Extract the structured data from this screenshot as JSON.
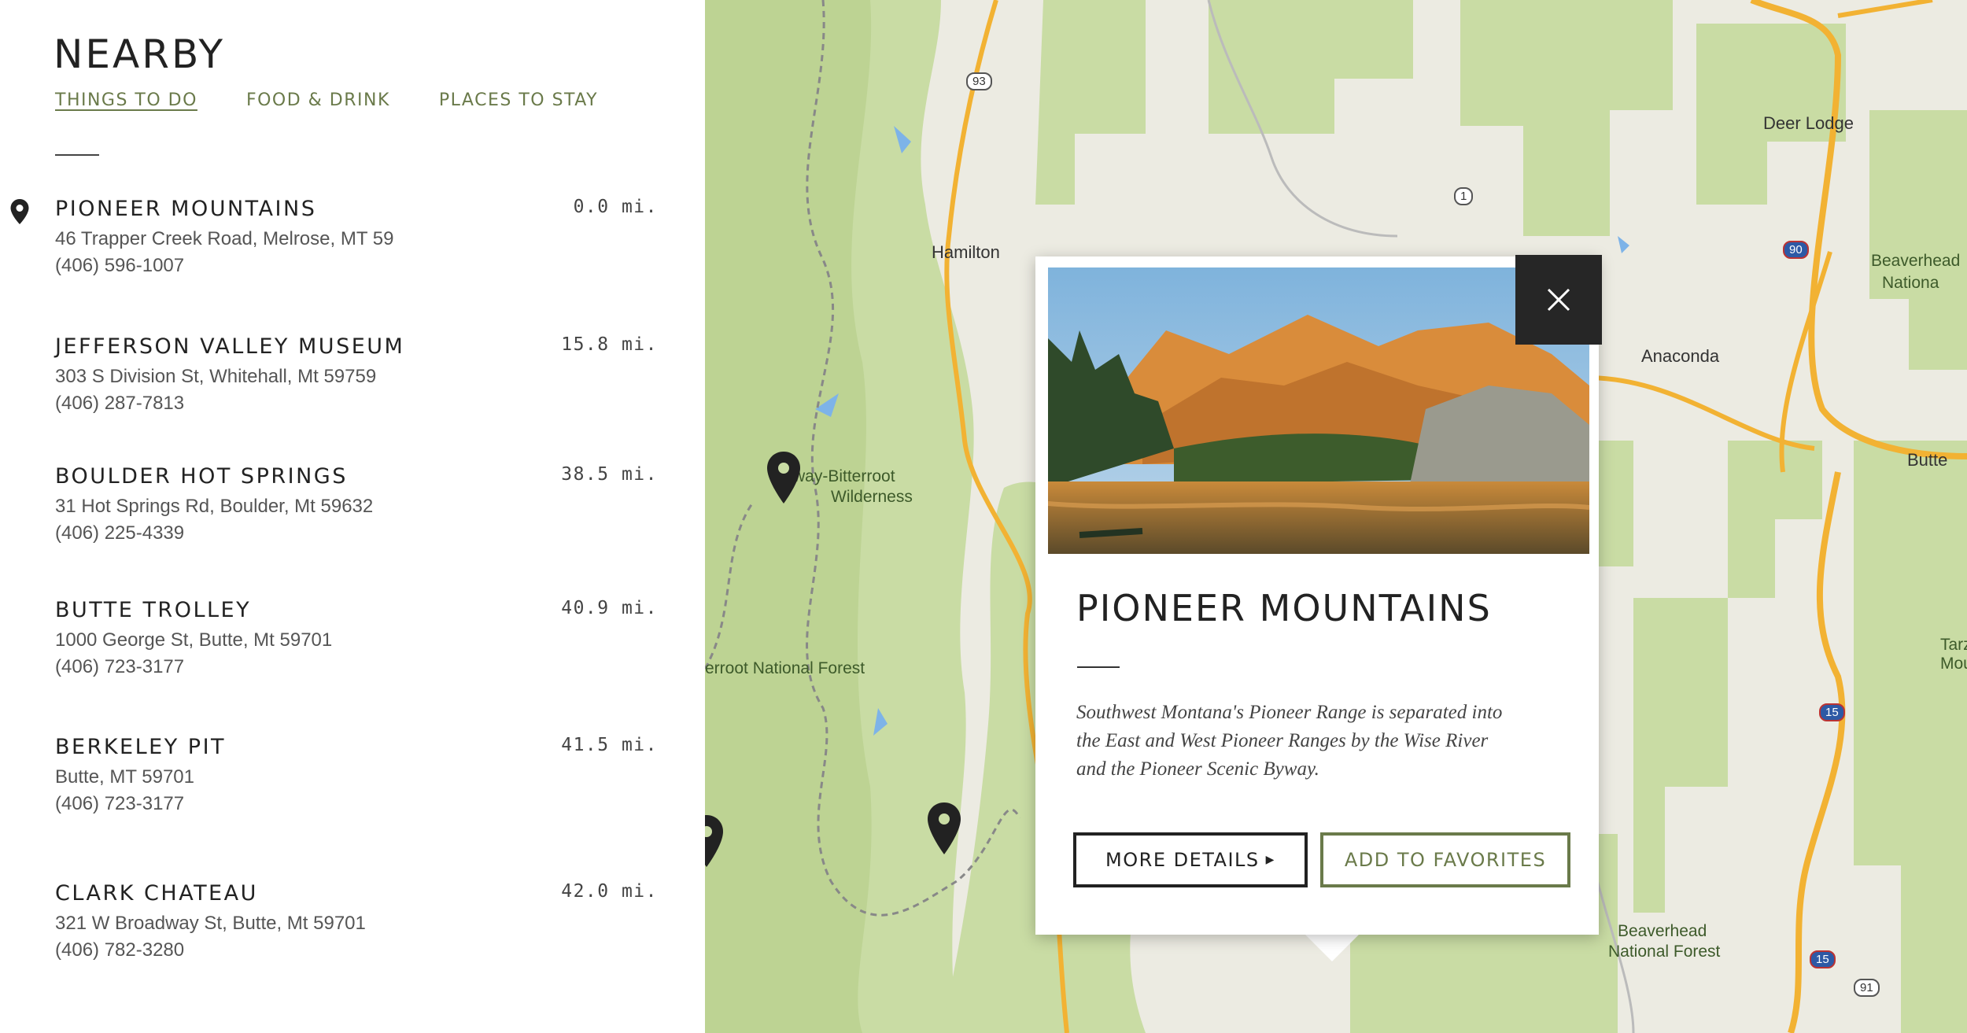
{
  "nearby": {
    "title": "NEARBY",
    "tabs": [
      {
        "label": "THINGS TO DO",
        "active": true
      },
      {
        "label": "FOOD & DRINK",
        "active": false
      },
      {
        "label": "PLACES TO STAY",
        "active": false
      }
    ],
    "items": [
      {
        "name": "PIONEER MOUNTAINS",
        "address": "46 Trapper Creek Road, Melrose, MT 59",
        "phone": "(406) 596-1007",
        "distance": "0.0 mi.",
        "selected": true
      },
      {
        "name": "JEFFERSON VALLEY MUSEUM",
        "address": "303 S Division St, Whitehall, Mt 59759",
        "phone": "(406) 287-7813",
        "distance": "15.8 mi.",
        "selected": false
      },
      {
        "name": "BOULDER HOT SPRINGS",
        "address": "31 Hot Springs Rd, Boulder, Mt 59632",
        "phone": "(406) 225-4339",
        "distance": "38.5 mi.",
        "selected": false
      },
      {
        "name": "BUTTE TROLLEY",
        "address": "1000 George St, Butte, Mt 59701",
        "phone": "(406) 723-3177",
        "distance": "40.9 mi.",
        "selected": false
      },
      {
        "name": "BERKELEY PIT",
        "address": "Butte, MT 59701",
        "phone": "(406) 723-3177",
        "distance": "41.5 mi.",
        "selected": false
      },
      {
        "name": "CLARK CHATEAU",
        "address": "321 W Broadway St, Butte, Mt 59701",
        "phone": "(406) 782-3280",
        "distance": "42.0 mi.",
        "selected": false
      }
    ]
  },
  "map": {
    "labels": {
      "hamilton": "Hamilton",
      "deer_lodge": "Deer Lodge",
      "anaconda": "Anaconda",
      "butte": "Butte",
      "bitterroot_wilderness_1": "way-Bitterroot",
      "bitterroot_wilderness_2": "Wilderness",
      "bitterroot_forest": "erroot National Forest",
      "beaverhead_forest_top_1": "Beaverhead",
      "beaverhead_forest_top_2": "Nationa",
      "beaverhead_forest_bottom_1": "Beaverhead",
      "beaverhead_forest_bottom_2": "National Forest",
      "right_edge_1": "Tarz",
      "right_edge_2": "Mou"
    },
    "road_badges": {
      "us93": "93",
      "mt1": "1",
      "i90": "90",
      "i15_a": "15",
      "i15_b": "15",
      "r91": "91"
    },
    "colors": {
      "forest": "#c7dd9e",
      "land": "#ecebe2",
      "road": "#f2b233",
      "water": "#7db3e8"
    }
  },
  "popup": {
    "title": "PIONEER MOUNTAINS",
    "description": "Southwest Montana's Pioneer Range is separated into the East and West Pioneer Ranges by the Wise River and the Pioneer Scenic Byway.",
    "more_details_label": "MORE DETAILS",
    "add_favorites_label": "ADD TO FAVORITES"
  }
}
